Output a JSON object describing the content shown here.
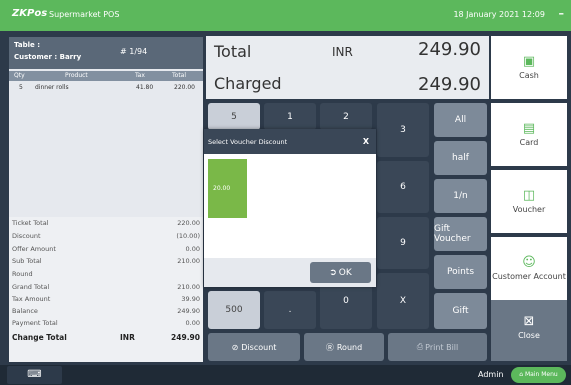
{
  "header": {
    "logo": "ZKPos",
    "title": "Supermarket POS",
    "datetime": "18 January 2021 12:09",
    "minimize": "–"
  },
  "ticket": {
    "table_label": "Table :",
    "customer_label": "Customer : Barry",
    "ticket_no": "# 1/94",
    "columns": [
      "Qty",
      "Product",
      "Tax",
      "Total"
    ],
    "items": [
      {
        "qty": "5",
        "product": "dinner rolls",
        "tax": "41.80",
        "total": "220.00"
      }
    ],
    "totals": {
      "ticket_total": {
        "label": "Ticket Total",
        "value": "220.00"
      },
      "discount": {
        "label": "Discount",
        "value": "(10.00)"
      },
      "offer_amount": {
        "label": "Offer Amount",
        "value": "0.00"
      },
      "sub_total": {
        "label": "Sub Total",
        "value": "210.00"
      },
      "round": {
        "label": "Round",
        "value": ""
      },
      "grand_total": {
        "label": "Grand Total",
        "value": "210.00"
      },
      "tax_amount": {
        "label": "Tax Amount",
        "value": "39.90"
      },
      "balance": {
        "label": "Balance",
        "value": "249.90"
      },
      "payment_total": {
        "label": "Payment Total",
        "value": "0.00"
      },
      "change_total": {
        "label": "Change Total",
        "currency": "INR",
        "value": "249.90"
      }
    }
  },
  "summary": {
    "total_label": "Total",
    "currency": "INR",
    "total_value": "249.90",
    "charged_label": "Charged",
    "charged_value": "249.90"
  },
  "keypad": {
    "k5": "5",
    "k1": "1",
    "k2": "2",
    "k3": "3",
    "k6": "6",
    "k9": "9",
    "k500": "500",
    "kdot": ".",
    "k0": "0",
    "kx": "X",
    "all": "All",
    "half": "half",
    "one_n": "1/n",
    "gift_voucher": "Gift Voucher",
    "points": "Points",
    "gift": "Gift"
  },
  "actions": {
    "discount": "Discount",
    "round": "Round",
    "print_bill": "Print Bill"
  },
  "sidebar": {
    "cash": "Cash",
    "card": "Card",
    "voucher": "Voucher",
    "customer_account": "Customer Account",
    "close": "Close"
  },
  "dialog": {
    "title": "Select Voucher Discount",
    "close": "X",
    "voucher_value": "20.00",
    "ok": "OK"
  },
  "status": {
    "user": "Admin",
    "main_menu": "Main Menu"
  },
  "colors": {
    "accent": "#5cb85c",
    "dark": "#2d3a4a",
    "voucher": "#7ab848"
  }
}
